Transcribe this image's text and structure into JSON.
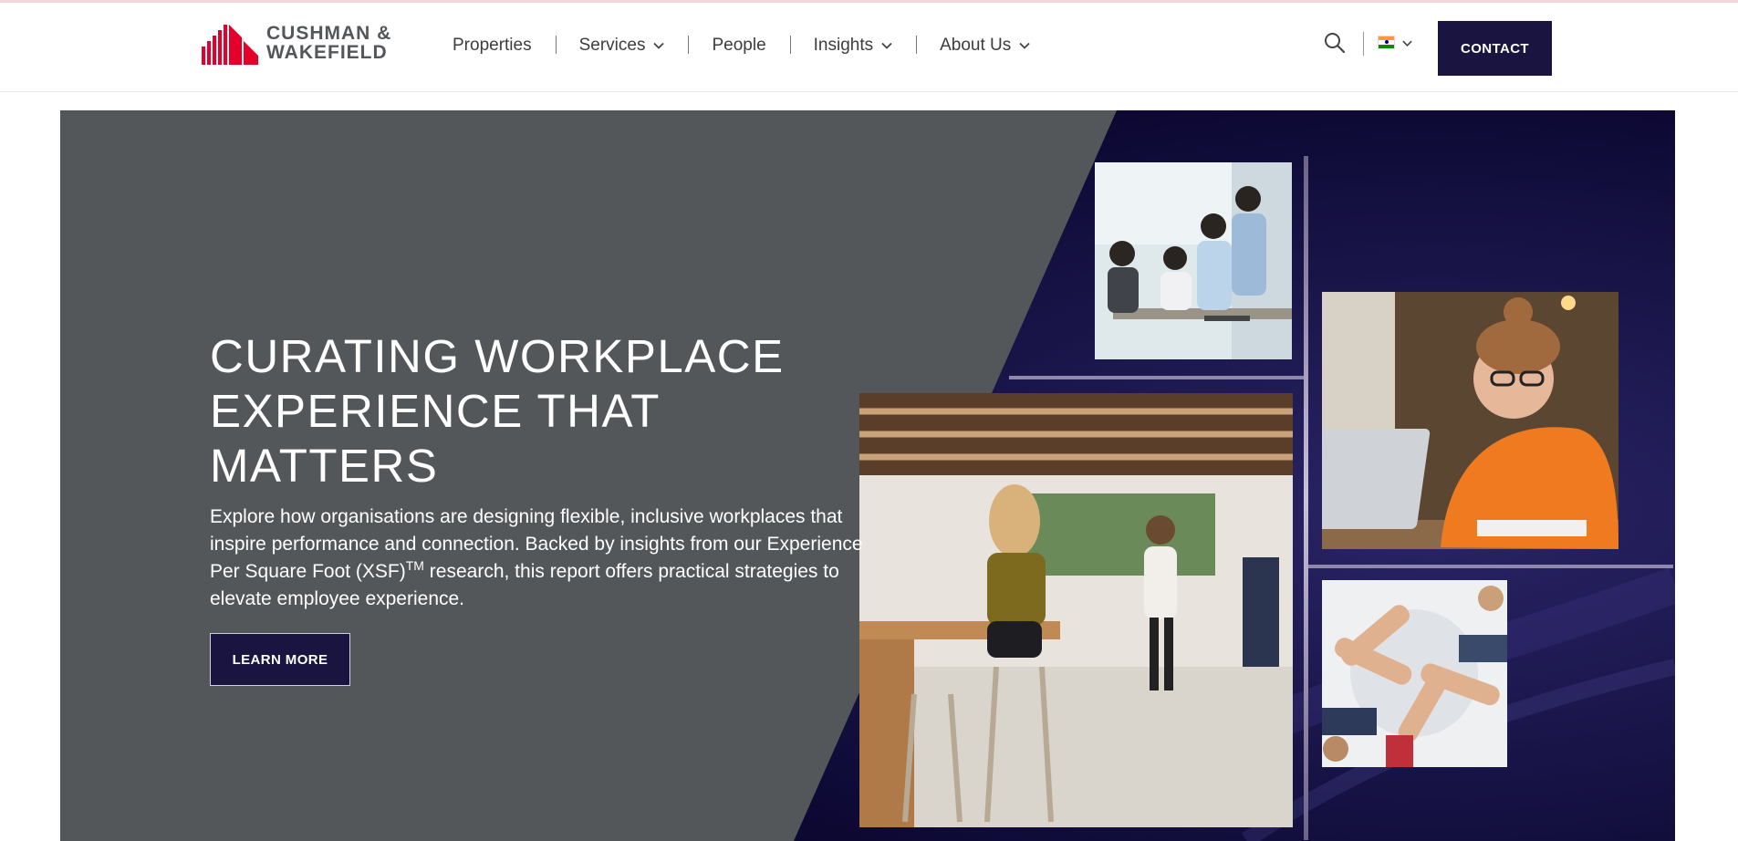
{
  "header": {
    "logo": {
      "line1": "CUSHMAN &",
      "line2": "WAKEFIELD",
      "brand_color": "#e4002b"
    },
    "nav": [
      {
        "label": "Properties",
        "has_dropdown": false
      },
      {
        "label": "Services",
        "has_dropdown": true
      },
      {
        "label": "People",
        "has_dropdown": false
      },
      {
        "label": "Insights",
        "has_dropdown": true
      },
      {
        "label": "About Us",
        "has_dropdown": true
      }
    ],
    "search_icon": "search-icon",
    "language": {
      "icon": "india-flag-icon"
    },
    "contact_label": "CONTACT"
  },
  "hero": {
    "headline": "CURATING WORKPLACE EXPERIENCE THAT MATTERS",
    "body_before": "Explore how organisations are designing flexible, inclusive workplaces that inspire performance and connection. Backed by insights from our Experience Per Square Foot (XSF)",
    "body_sup": "TM",
    "body_after": " research, this report offers practical strategies to elevate employee experience.",
    "cta_label": "LEARN MORE",
    "colors": {
      "grey_panel": "#545759",
      "navy": "#0e0a34",
      "button": "#1a1540"
    }
  }
}
